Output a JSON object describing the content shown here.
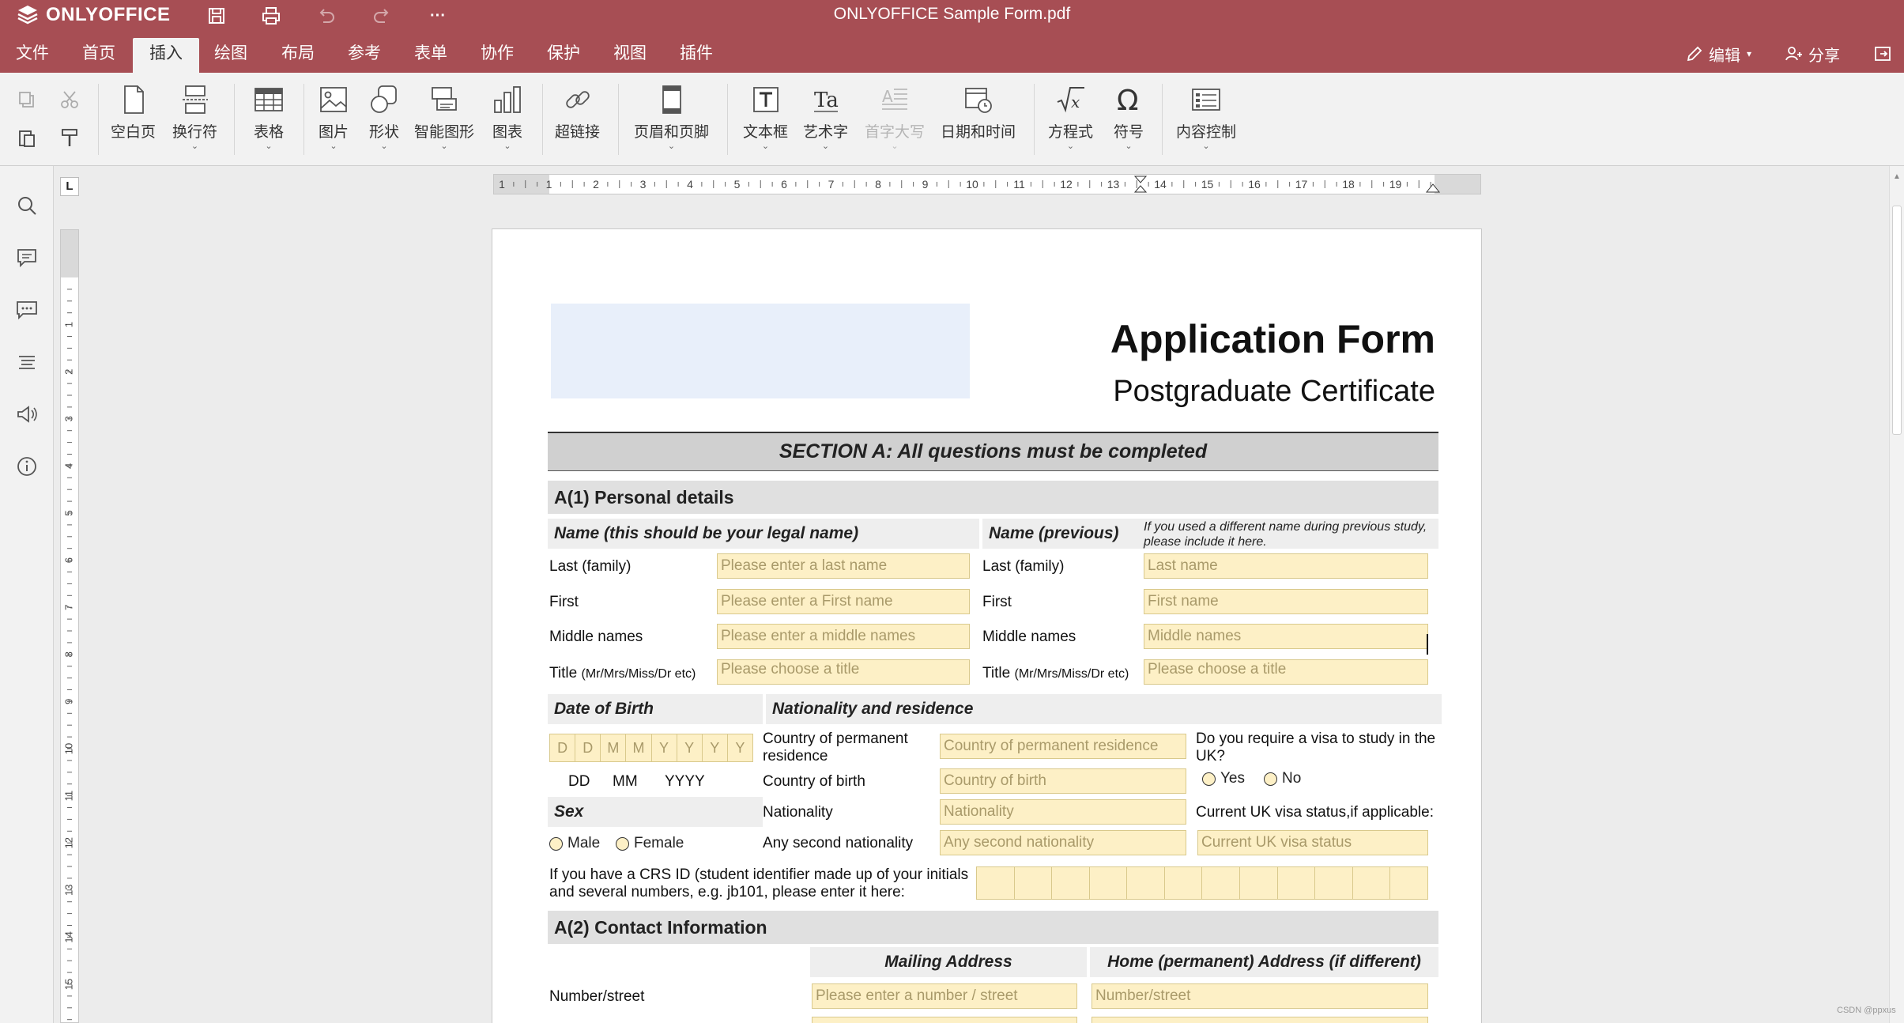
{
  "app": {
    "brand": "ONLYOFFICE",
    "doc_title": "ONLYOFFICE Sample Form.pdf",
    "more": "···"
  },
  "menu": {
    "tabs": [
      "文件",
      "首页",
      "插入",
      "绘图",
      "布局",
      "参考",
      "表单",
      "协作",
      "保护",
      "视图",
      "插件"
    ],
    "active_tab": "插入",
    "edit": "编辑",
    "share": "分享"
  },
  "ribbon": {
    "blank_page": "空白页",
    "break": "换行符",
    "table": "表格",
    "image": "图片",
    "shape": "形状",
    "smartart": "智能图形",
    "chart": "图表",
    "hyperlink": "超链接",
    "header_footer": "页眉和页脚",
    "textbox": "文本框",
    "textart": "艺术字",
    "dropcap": "首字大写",
    "datetime": "日期和时间",
    "equation": "方程式",
    "symbol": "符号",
    "content_control": "内容控制"
  },
  "ruler": {
    "h_numbers": [
      "1",
      "1",
      "2",
      "3",
      "4",
      "5",
      "6",
      "7",
      "8",
      "9",
      "10",
      "11",
      "12",
      "13",
      "14",
      "15",
      "16",
      "17",
      "18",
      "19"
    ],
    "v_numbers": [
      "1",
      "2",
      "3",
      "4",
      "5",
      "6",
      "7",
      "8",
      "9",
      "10",
      "11",
      "12",
      "13",
      "14",
      "15"
    ],
    "corner": "L"
  },
  "form": {
    "title": "Application Form",
    "subtitle": "Postgraduate Certificate",
    "section_a": "SECTION A: All questions must be completed",
    "a1": "A(1) Personal details",
    "name_legal": "Name (this should be your legal name)",
    "name_previous": "Name (previous)",
    "name_previous_note": "If you used a different name during previous study, please include it here.",
    "labels": {
      "last": "Last (family)",
      "first": "First",
      "middle": "Middle names",
      "title": "Title",
      "title_hint": "(Mr/Mrs/Miss/Dr etc)"
    },
    "legal_fields": {
      "last": "Please enter a last name",
      "first": "Please enter a First name",
      "middle": "Please enter a middle names",
      "title": "Please choose a title"
    },
    "prev_fields": {
      "last": "Last name",
      "first": "First name",
      "middle": "Middle names",
      "title": "Please choose a title"
    },
    "dob": "Date of Birth",
    "dob_cells": [
      "D",
      "D",
      "M",
      "M",
      "Y",
      "Y",
      "Y",
      "Y"
    ],
    "dob_hints": {
      "dd": "DD",
      "mm": "MM",
      "yyyy": "YYYY"
    },
    "nationality_residence": "Nationality and residence",
    "country_perm_label": "Country of permanent residence",
    "country_perm_field": "Country of permanent residence",
    "country_birth_label": "Country of birth",
    "country_birth_field": "Country of birth",
    "nationality_label": "Nationality",
    "nationality_field": "Nationality",
    "second_nat_label": "Any second nationality",
    "second_nat_field": "Any second nationality",
    "visa_q": "Do you require a visa to study in the UK?",
    "yes": "Yes",
    "no": "No",
    "visa_status_label": "Current UK visa status,if applicable:",
    "visa_status_field": "Current UK visa status",
    "sex": "Sex",
    "male": "Male",
    "female": "Female",
    "crs_text_1": "If you have a CRS ID (student identifier made up of your initials",
    "crs_text_2": "and several numbers, e.g. jb101, please enter it here:",
    "a2": "A(2) Contact Information",
    "mailing": "Mailing Address",
    "home": "Home (permanent) Address (if different)",
    "number_street_label": "Number/street",
    "mailing_field": "Please enter a number / street",
    "home_field": "Number/street"
  },
  "watermark": "CSDN @ppxus",
  "colors": {
    "brand": "#a74e54",
    "field_bg": "#fdf0c6",
    "logo_box": "#e8effa"
  }
}
